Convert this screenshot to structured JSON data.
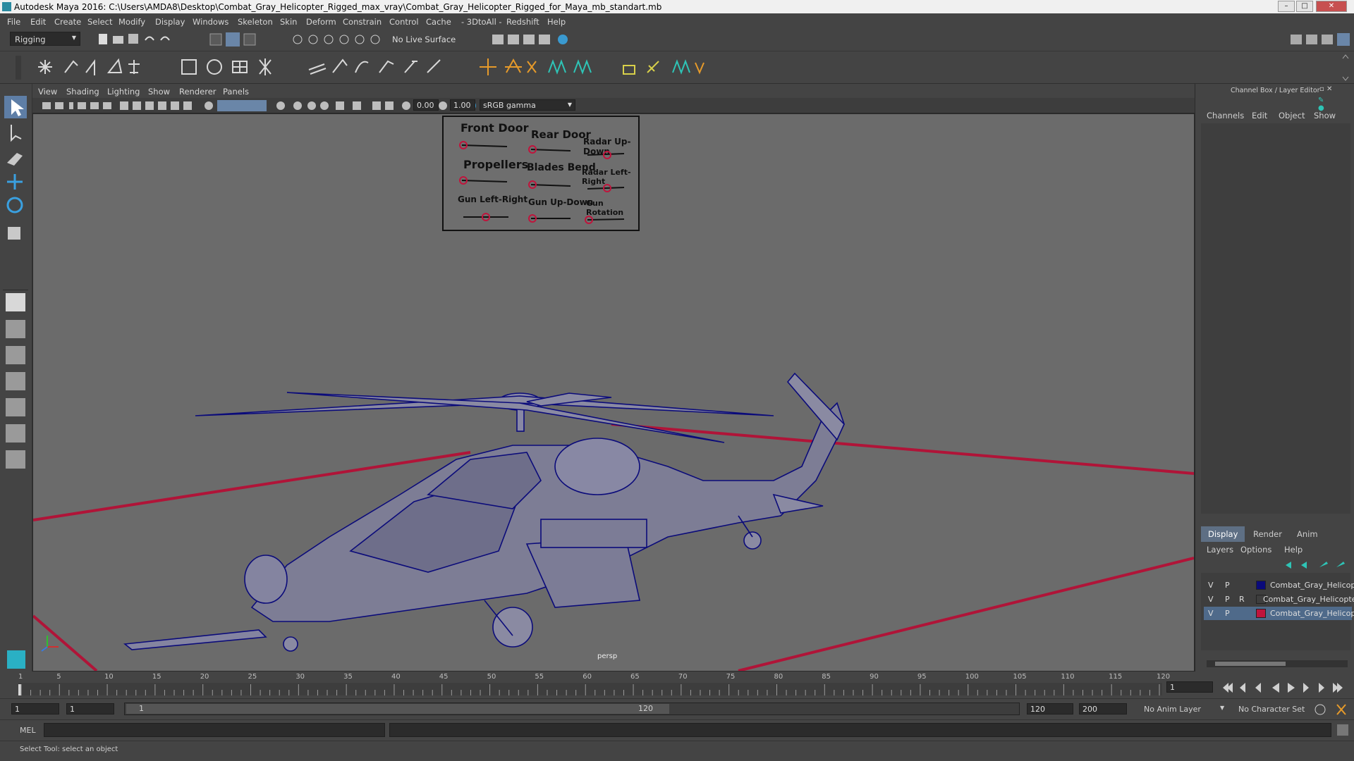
{
  "window": {
    "title": "Autodesk Maya 2016: C:\\Users\\AMDA8\\Desktop\\Combat_Gray_Helicopter_Rigged_max_vray\\Combat_Gray_Helicopter_Rigged_for_Maya_mb_standart.mb",
    "minimize": "–",
    "maximize": "□",
    "close": "✕"
  },
  "menubar": [
    "File",
    "Edit",
    "Create",
    "Select",
    "Modify",
    "Display",
    "Windows",
    "Skeleton",
    "Skin",
    "Deform",
    "Constrain",
    "Control",
    "Cache",
    "- 3DtoAll -",
    "Redshift",
    "Help"
  ],
  "toolbar": {
    "menu_set": "Rigging",
    "live_surface": "No Live Surface"
  },
  "panel": {
    "menus": [
      "View",
      "Shading",
      "Lighting",
      "Show",
      "Renderer",
      "Panels"
    ],
    "exposure": "0.00",
    "gamma": "1.00",
    "color_space": "sRGB gamma",
    "camera_label": "persp"
  },
  "control_board": {
    "labels": [
      "Front Door",
      "Rear Door",
      "Radar Up-Down",
      "Propellers",
      "Blades Bend",
      "Radar Left-Right",
      "Gun Left-Right",
      "Gun Up-Down",
      "Gun Rotation"
    ]
  },
  "channel_box": {
    "title": "Channel Box / Layer Editor",
    "menus": [
      "Channels",
      "Edit",
      "Object",
      "Show"
    ],
    "tabs": [
      "Display",
      "Render",
      "Anim"
    ],
    "layer_menus": [
      "Layers",
      "Options",
      "Help"
    ],
    "layers": [
      {
        "v": "V",
        "p": "P",
        "r": "",
        "name": "Combat_Gray_Helicopt",
        "color": "#0a0a7a"
      },
      {
        "v": "V",
        "p": "P",
        "r": "R",
        "name": "Combat_Gray_Helicopter",
        "color": ""
      },
      {
        "v": "V",
        "p": "P",
        "r": "",
        "name": "Combat_Gray_Helicopt",
        "color": "#c0143c"
      }
    ]
  },
  "timeline": {
    "ticks": [
      "1",
      "5",
      "10",
      "15",
      "20",
      "25",
      "30",
      "35",
      "40",
      "45",
      "50",
      "55",
      "60",
      "65",
      "70",
      "75",
      "80",
      "85",
      "90",
      "95",
      "100",
      "105",
      "110",
      "115",
      "120"
    ],
    "current_frame": "1"
  },
  "range": {
    "start": "1",
    "playback_start": "1",
    "slider_start": "1",
    "slider_end": "120",
    "playback_end": "120",
    "end": "200",
    "anim_layer": "No Anim Layer",
    "character_set": "No Character Set"
  },
  "command": {
    "lang": "MEL"
  },
  "help_line": "Select Tool: select an object",
  "colors": {
    "wire": "#0b0b7a",
    "grid_axis": "#b01438",
    "viewport": "#6b6b6b"
  }
}
